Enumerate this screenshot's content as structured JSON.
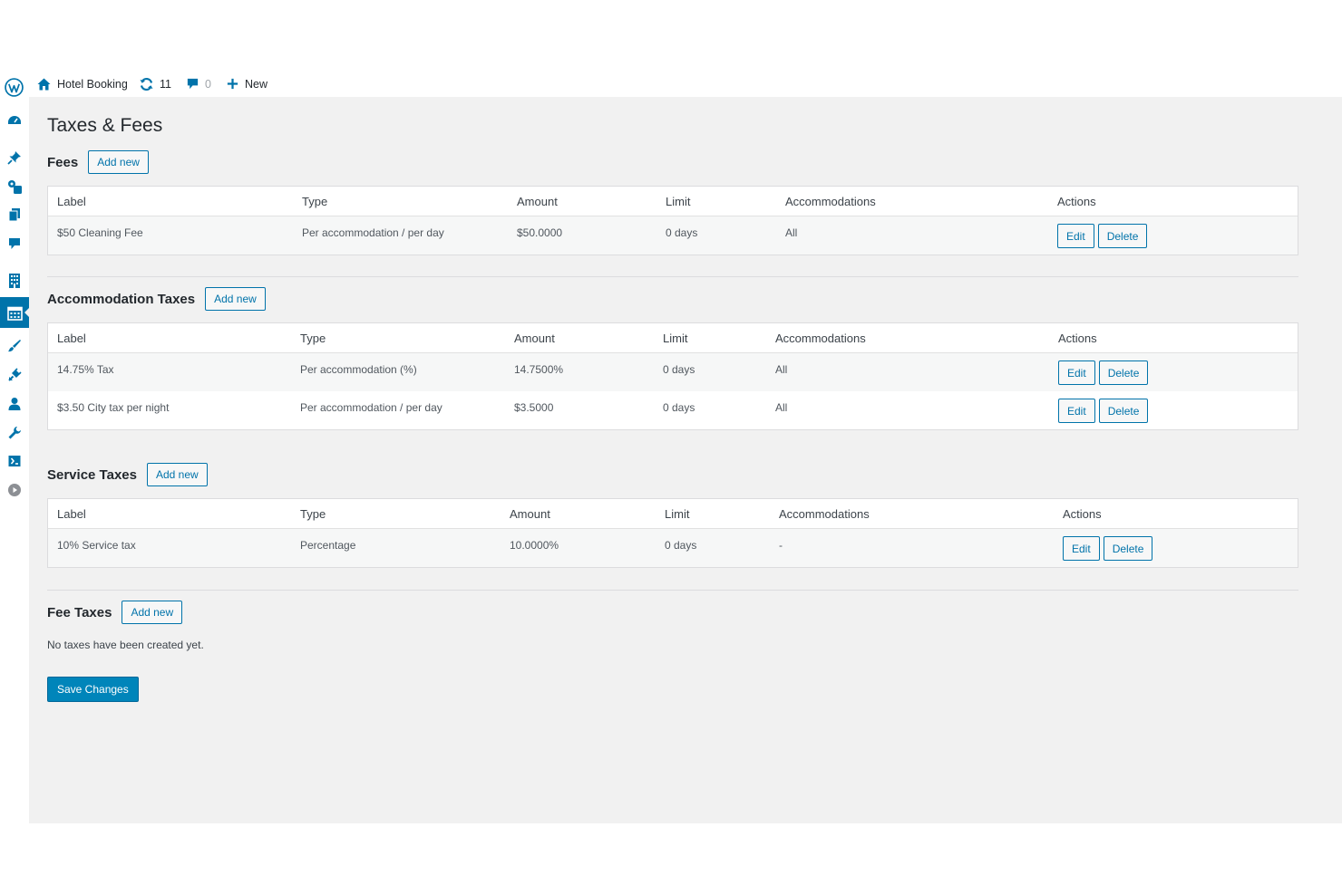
{
  "adminbar": {
    "site_name": "Hotel Booking",
    "updates_count": "11",
    "comments_count": "0",
    "new_label": "New"
  },
  "page": {
    "title": "Taxes & Fees"
  },
  "columns": {
    "label": "Label",
    "type": "Type",
    "amount": "Amount",
    "limit": "Limit",
    "accommodations": "Accommodations",
    "actions": "Actions"
  },
  "buttons": {
    "add_new": "Add new",
    "edit": "Edit",
    "delete": "Delete",
    "save": "Save Changes"
  },
  "fees": {
    "title": "Fees",
    "rows": [
      {
        "label": "$50 Cleaning Fee",
        "type": "Per accommodation / per day",
        "amount": "$50.0000",
        "limit": "0 days",
        "accommodations": "All"
      }
    ]
  },
  "accommodation_taxes": {
    "title": "Accommodation Taxes",
    "rows": [
      {
        "label": "14.75% Tax",
        "type": "Per accommodation (%)",
        "amount": "14.7500%",
        "limit": "0 days",
        "accommodations": "All"
      },
      {
        "label": "$3.50 City tax per night",
        "type": "Per accommodation / per day",
        "amount": "$3.5000",
        "limit": "0 days",
        "accommodations": "All"
      }
    ]
  },
  "service_taxes": {
    "title": "Service Taxes",
    "rows": [
      {
        "label": "10% Service tax",
        "type": "Percentage",
        "amount": "10.0000%",
        "limit": "0 days",
        "accommodations": "-"
      }
    ]
  },
  "fee_taxes": {
    "title": "Fee Taxes",
    "empty_message": "No taxes have been created yet."
  },
  "colors": {
    "accent": "#0073aa",
    "primary_button": "#0085ba",
    "content_bg": "#f1f1f1"
  },
  "icons": {
    "adminbar": [
      "wordpress-logo-icon",
      "home-icon",
      "updates-icon",
      "comments-icon",
      "plus-icon"
    ],
    "sidebar": [
      "dashboard-icon",
      "posts-pin-icon",
      "media-icon",
      "pages-icon",
      "comments-icon",
      "accommodations-building-icon",
      "bookings-calendar-icon",
      "appearance-brush-icon",
      "plugins-icon",
      "users-icon",
      "tools-wrench-icon",
      "settings-icon",
      "play-circle-icon"
    ]
  }
}
